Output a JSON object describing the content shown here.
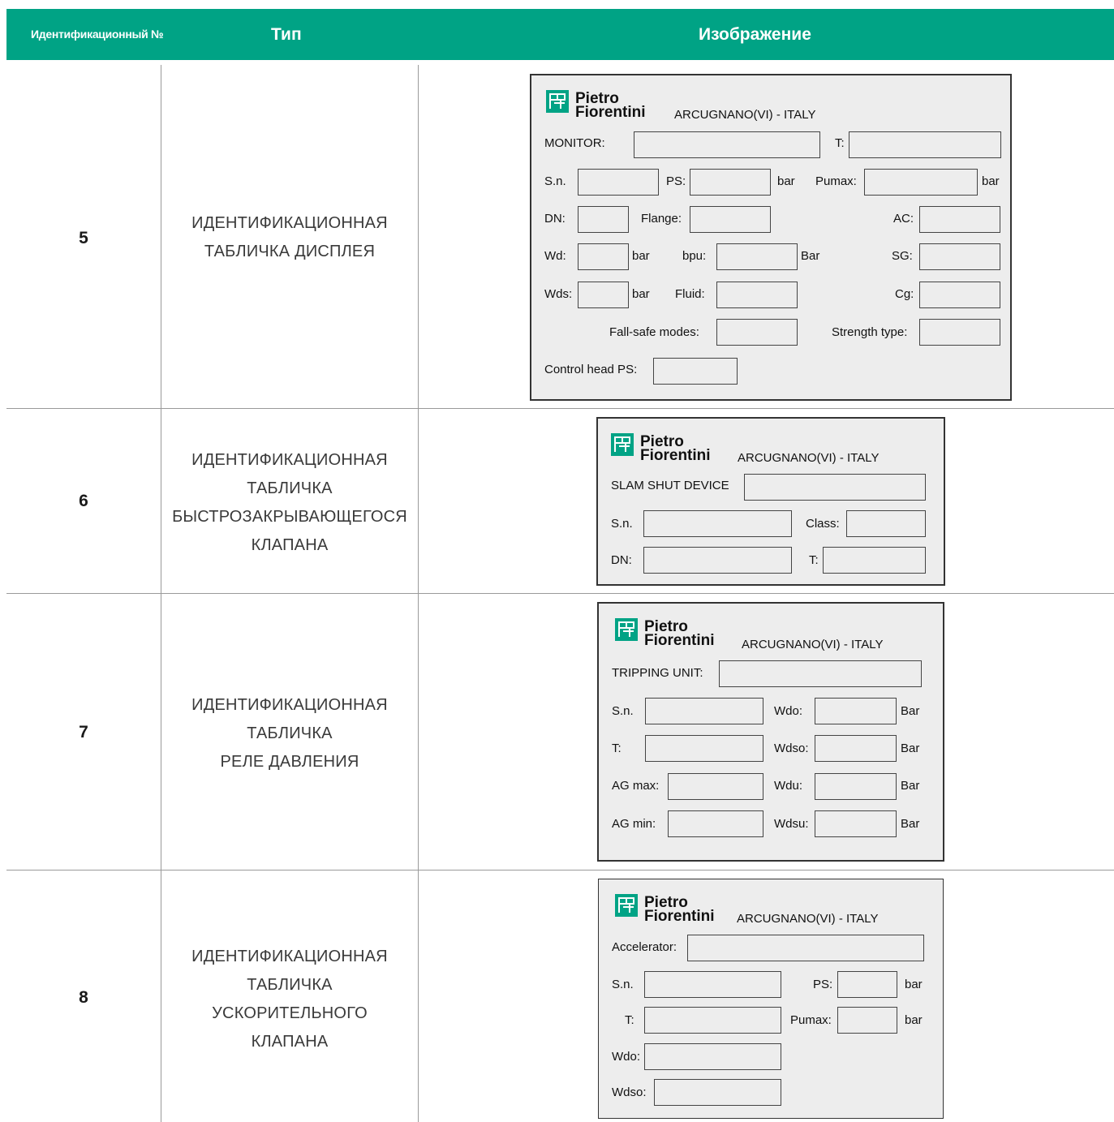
{
  "header": {
    "id_label": "Идентификационный №",
    "type_label": "Тип",
    "image_label": "Изображение"
  },
  "brand": {
    "name_line1": "Pietro",
    "name_line2": "Fiorentini",
    "location": "ARCUGNANO(VI) - ITALY",
    "logo_color": "#00a385"
  },
  "rows": [
    {
      "number": "5",
      "type_lines": [
        "ИДЕНТИФИКАЦИОННАЯ",
        "ТАБЛИЧКА ДИСПЛЕЯ"
      ],
      "labels": {
        "monitor": "MONITOR:",
        "t": "T:",
        "sn": "S.n.",
        "ps": "PS:",
        "bar1": "bar",
        "pumax": "Pumax:",
        "bar2": "bar",
        "dn": "DN:",
        "flange": "Flange:",
        "ac": "AC:",
        "wd": "Wd:",
        "bar3": "bar",
        "bpu": "bpu:",
        "bar4": "Bar",
        "sg": "SG:",
        "wds": "Wds:",
        "bar5": "bar",
        "fluid": "Fluid:",
        "cg": "Cg:",
        "failsafe": "Fall-safe modes:",
        "strength": "Strength type:",
        "controlhead": "Control head PS:"
      }
    },
    {
      "number": "6",
      "type_lines": [
        "ИДЕНТИФИКАЦИОННАЯ",
        "ТАБЛИЧКА",
        "БЫСТРОЗАКРЫВАЮЩЕГОСЯ",
        "КЛАПАНА"
      ],
      "labels": {
        "device": "SLAM SHUT DEVICE",
        "sn": "S.n.",
        "class": "Class:",
        "dn": "DN:",
        "t": "T:"
      }
    },
    {
      "number": "7",
      "type_lines": [
        "ИДЕНТИФИКАЦИОННАЯ",
        "ТАБЛИЧКА",
        "РЕЛЕ ДАВЛЕНИЯ"
      ],
      "labels": {
        "unit": "TRIPPING UNIT:",
        "sn": "S.n.",
        "wdo": "Wdo:",
        "bar1": "Bar",
        "t": "T:",
        "wdso": "Wdso:",
        "bar2": "Bar",
        "agmax": "AG max:",
        "wdu": "Wdu:",
        "bar3": "Bar",
        "agmin": "AG min:",
        "wdsu": "Wdsu:",
        "bar4": "Bar"
      }
    },
    {
      "number": "8",
      "type_lines": [
        "ИДЕНТИФИКАЦИОННАЯ",
        "ТАБЛИЧКА",
        "УСКОРИТЕЛЬНОГО",
        "КЛАПАНА"
      ],
      "labels": {
        "accel": "Accelerator:",
        "sn": "S.n.",
        "ps": "PS:",
        "bar1": "bar",
        "t": "T:",
        "pumax": "Pumax:",
        "bar2": "bar",
        "wdo": "Wdo:",
        "wdso": "Wdso:"
      }
    }
  ]
}
